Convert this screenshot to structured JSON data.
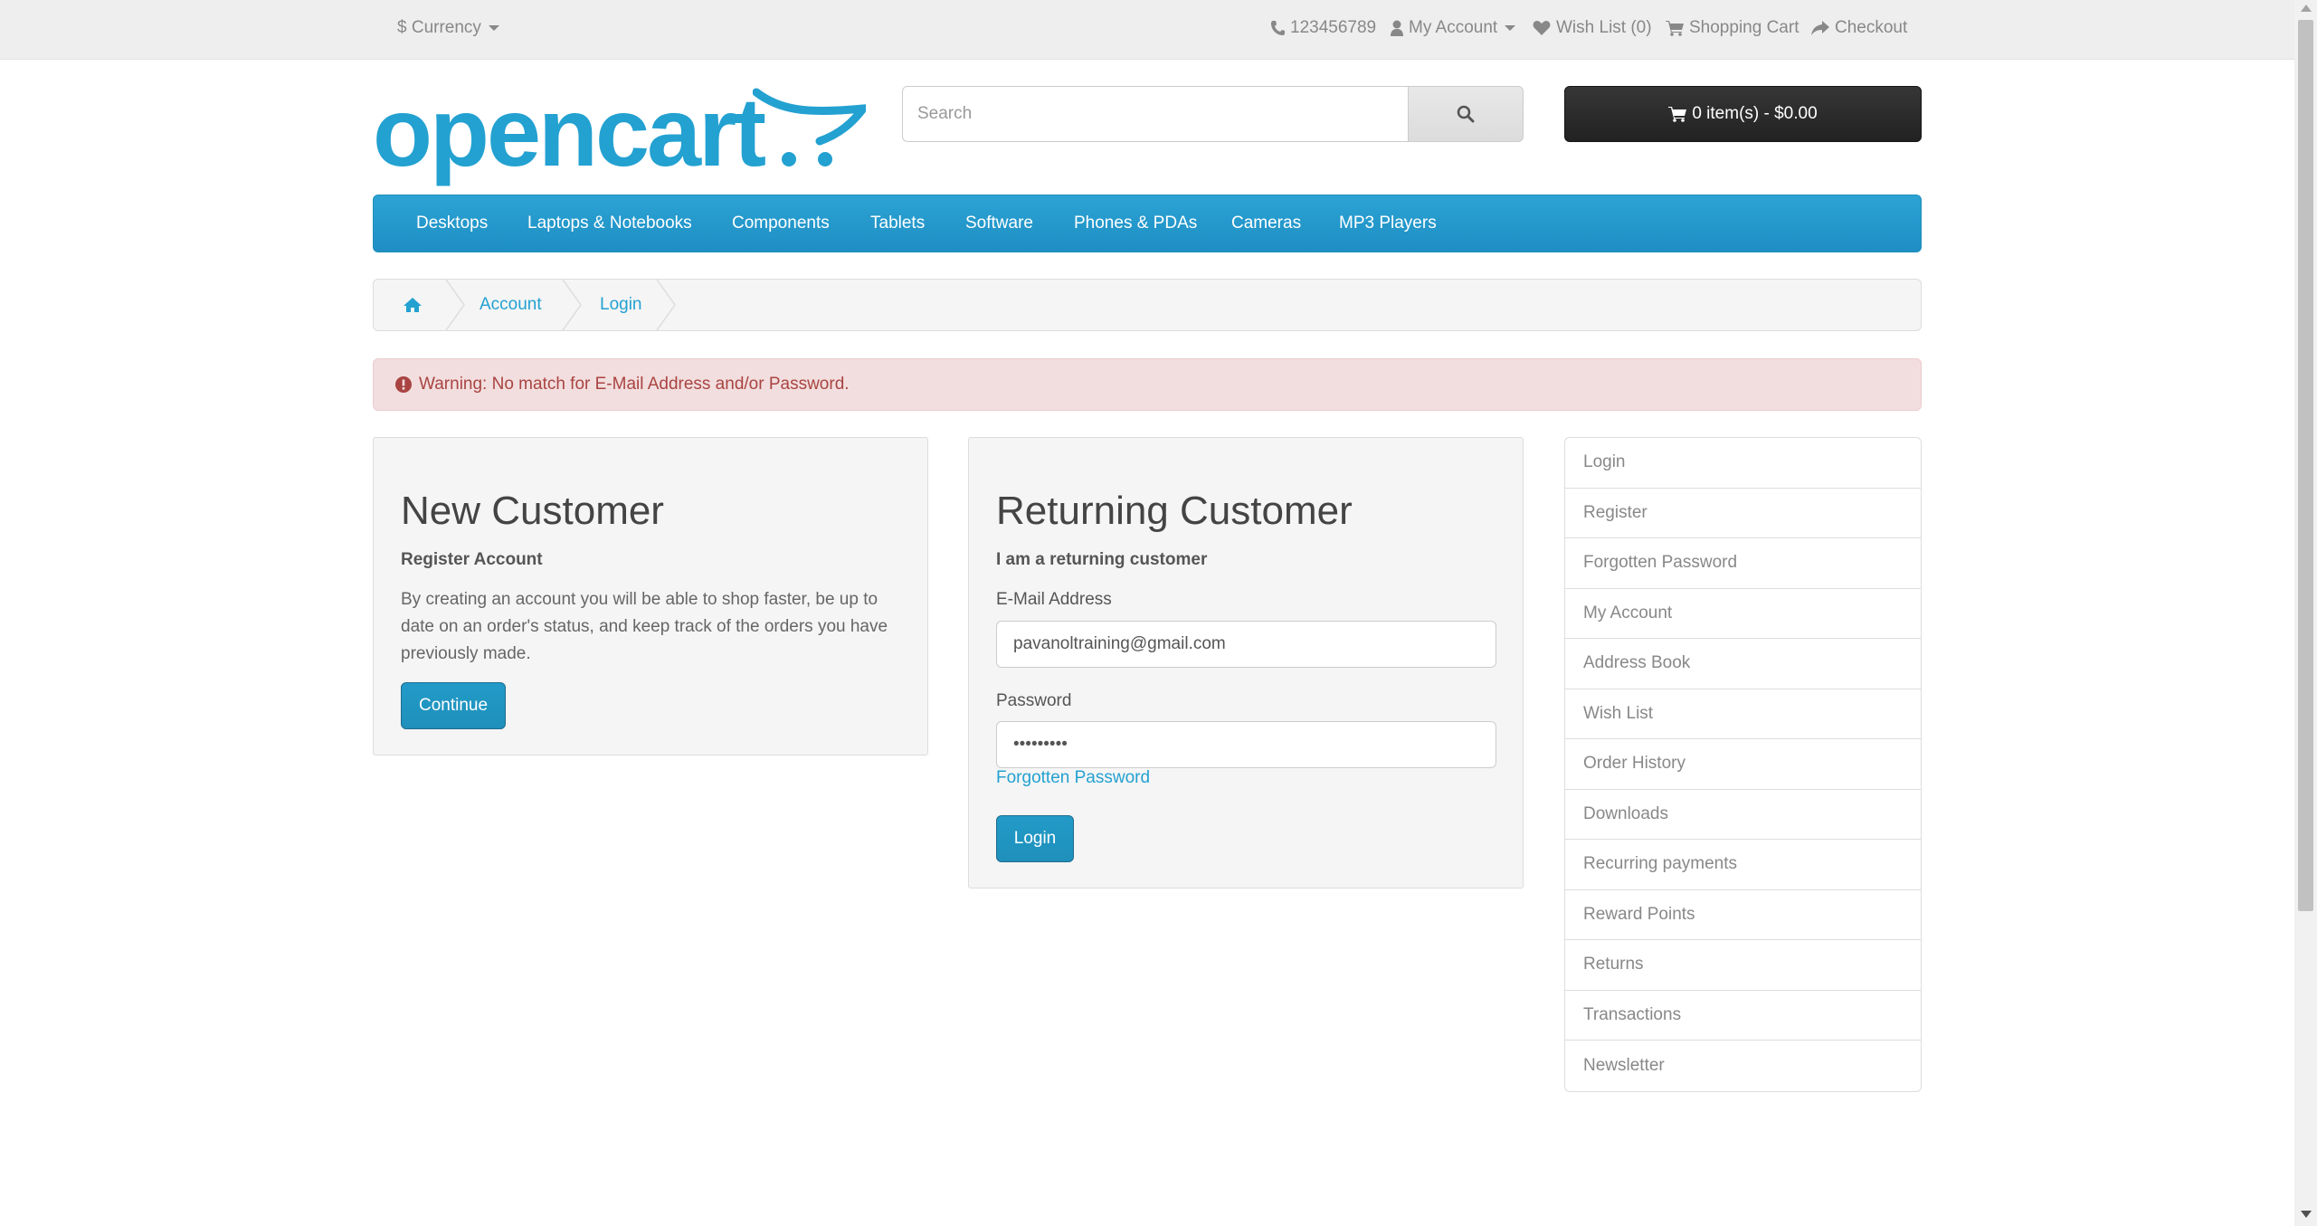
{
  "topbar": {
    "currency_label": "$ Currency",
    "phone": "123456789",
    "my_account": "My Account",
    "wish_list": "Wish List (0)",
    "shopping_cart": "Shopping Cart",
    "checkout": "Checkout"
  },
  "logo": {
    "text": "opencart"
  },
  "search": {
    "placeholder": "Search",
    "value": ""
  },
  "cart": {
    "label": "0 item(s) - $0.00"
  },
  "menu": {
    "items": [
      "Desktops",
      "Laptops & Notebooks",
      "Components",
      "Tablets",
      "Software",
      "Phones & PDAs",
      "Cameras",
      "MP3 Players"
    ]
  },
  "breadcrumb": {
    "items": [
      "Account",
      "Login"
    ]
  },
  "alert": {
    "text": "Warning: No match for E-Mail Address and/or Password."
  },
  "new_customer": {
    "title": "New Customer",
    "subtitle": "Register Account",
    "description": "By creating an account you will be able to shop faster, be up to date on an order's status, and keep track of the orders you have previously made.",
    "continue_label": "Continue"
  },
  "returning_customer": {
    "title": "Returning Customer",
    "subtitle": "I am a returning customer",
    "email_label": "E-Mail Address",
    "email_value": "pavanoltraining@gmail.com",
    "password_label": "Password",
    "password_value": "•••••••••",
    "forgotten_label": "Forgotten Password",
    "login_label": "Login"
  },
  "account_list": {
    "items": [
      "Login",
      "Register",
      "Forgotten Password",
      "My Account",
      "Address Book",
      "Wish List",
      "Order History",
      "Downloads",
      "Recurring payments",
      "Reward Points",
      "Returns",
      "Transactions",
      "Newsletter"
    ]
  },
  "colors": {
    "accent": "#23a1d1",
    "menu_bg": "#229ac8",
    "alert_bg": "#f2dede",
    "alert_text": "#a94442",
    "cart_bg": "#303030"
  }
}
